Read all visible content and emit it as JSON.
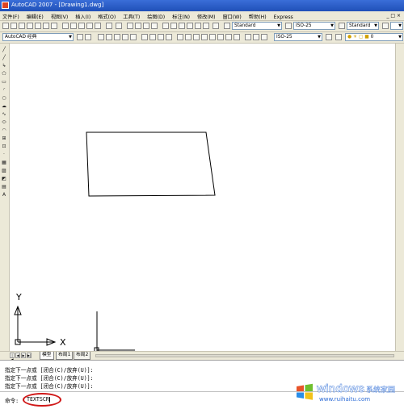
{
  "window": {
    "title": "AutoCAD 2007 - [Drawing1.dwg]"
  },
  "menu": {
    "items": [
      "文件(F)",
      "编辑(E)",
      "视图(V)",
      "插入(I)",
      "格式(O)",
      "工具(T)",
      "绘图(D)",
      "标注(N)",
      "修改(M)",
      "窗口(W)",
      "帮助(H)",
      "Express"
    ],
    "window_controls": "_ □ ×"
  },
  "toolbar": {
    "workspace": "AutoCAD 经典",
    "text_style": "Standard",
    "dim_style_1": "ISO-25",
    "dim_style_2": "ISO-25",
    "dim_style_3": "ISO-25",
    "text_style_2": "Standard",
    "layer": "0"
  },
  "ucs": {
    "x_label": "X",
    "y_label": "Y"
  },
  "tabs": {
    "model": "模型",
    "layout1": "布局1",
    "layout2": "布局2"
  },
  "command": {
    "history": [
      "指定下一点或 [闭合(C)/放弃(U)]:",
      "指定下一点或 [闭合(C)/放弃(U)]:",
      "指定下一点或 [闭合(C)/放弃(U)]:"
    ],
    "prompt": "命令:",
    "input_value": "TEXTSCR",
    "highlight_color": "#d01818"
  },
  "watermark": {
    "brand": "windows",
    "brand_cn": "系统家园",
    "url": "www.ruihaitu.com"
  }
}
